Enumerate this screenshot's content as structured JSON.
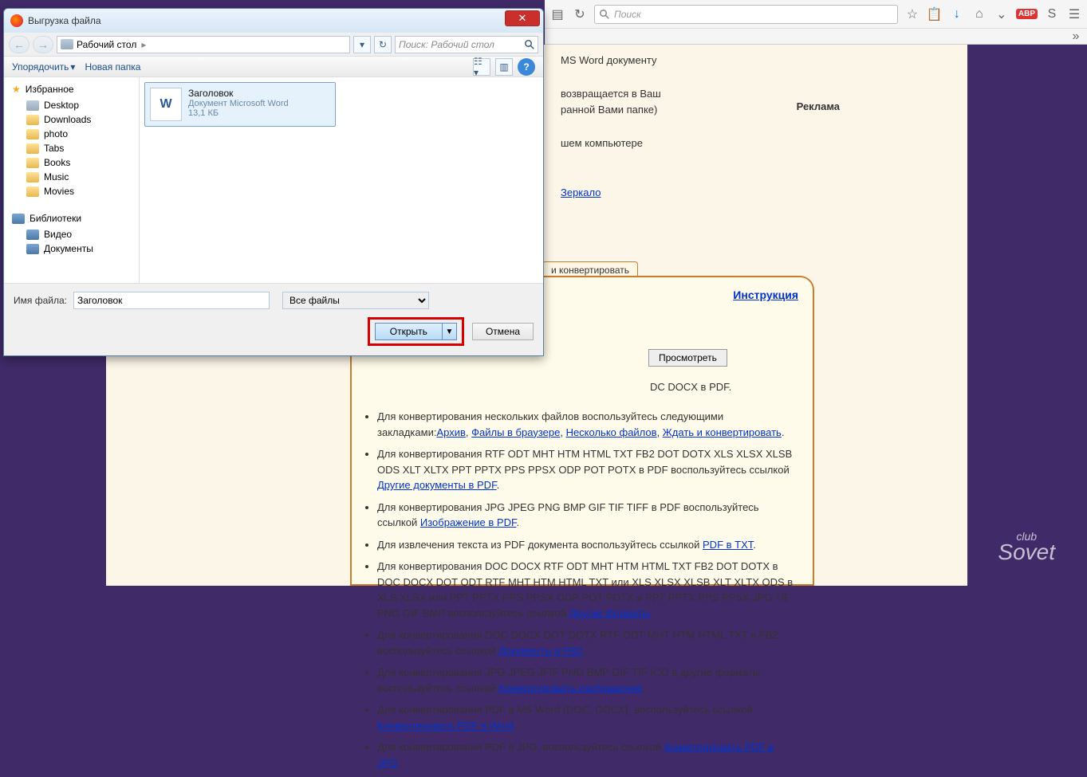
{
  "toolbar": {
    "search_placeholder": "Поиск"
  },
  "page": {
    "headline_frag": "MS Word документу",
    "reklama": "Реклама",
    "line2a": "возвращается в Ваш",
    "line2b": "ранной Вами папке)",
    "line3": "шем компьютере",
    "mirror": "Зеркало",
    "tab_convert": "и конвертировать",
    "instruction": "Инструкция",
    "browse": "Просмотреть",
    "docx_line": "DC DOCX в PDF.",
    "logo1": "club",
    "logo2": "Sovet"
  },
  "bullets": [
    {
      "pre": "Для конвертирования нескольких файлов воспользуйтесь следующими закладками:",
      "links": [
        "Архив",
        "Файлы в браузере",
        "Несколько файлов",
        "Ждать и конвертировать"
      ],
      "post": "."
    },
    {
      "pre": "Для конвертирования RTF ODT MHT HTM HTML TXT FB2 DOT DOTX XLS XLSX XLSB ODS XLT XLTX PPT PPTX PPS PPSX ODP POT POTX в PDF воспользуйтесь ссылкой ",
      "links": [
        "Другие документы в PDF"
      ],
      "post": "."
    },
    {
      "pre": "Для конвертирования JPG JPEG PNG BMP GIF TIF TIFF в PDF воспользуйтесь ссылкой ",
      "links": [
        "Изображение в PDF"
      ],
      "post": "."
    },
    {
      "pre": "Для извлечения текста из PDF документа воспользуйтесь ссылкой ",
      "links": [
        "PDF в TXT"
      ],
      "post": "."
    },
    {
      "pre": "Для конвертирования DOC DOCX RTF ODT MHT HTM HTML TXT FB2 DOT DOTX в DOC DOCX DOT ODT RTF MHT HTM HTML TXT или XLS XLSX XLSB XLT XLTX ODS в XLS XLSX или PPT PPTX PPS PPSX ODP POT POTX в PPT PPTX PPS PPSX JPG TIF PNG GIF BMP воспользуйтесь ссылкой ",
      "links": [
        "Другие форматы"
      ],
      "post": "."
    },
    {
      "pre": "Для конвертирования DOC DOCX DOT DOTX RTF ODT MHT HTM HTML TXT в FB2 воспользуйтесь ссылкой ",
      "links": [
        "Документы в FB2"
      ],
      "post": "."
    },
    {
      "pre": "Для конвертирования JPG JPEG JFIF PNG BMP GIF TIF ICO в другие форматы, воспользуйтесь ссылкой ",
      "links": [
        "Конвертировать изображение"
      ],
      "post": "."
    },
    {
      "pre": "Для конвертирования PDF в MS Word (DOC, DOCX), воспользуйтесь ссылкой ",
      "links": [
        "Конвертировать PDF в Word"
      ],
      "post": "."
    },
    {
      "pre": "Для конвертирования PDF в JPG, воспользуйтесь ссылкой ",
      "links": [
        "Конвертировать PDF в JPG"
      ],
      "post": "."
    }
  ],
  "dialog": {
    "title": "Выгрузка файла",
    "crumb": "Рабочий стол",
    "search_placeholder": "Поиск: Рабочий стол",
    "organize": "Упорядочить",
    "new_folder": "Новая папка",
    "fav": "Избранное",
    "fav_items": [
      "Desktop",
      "Downloads",
      "photo",
      "Tabs",
      "Books",
      "Music",
      "Movies"
    ],
    "lib": "Библиотеки",
    "lib_items": [
      "Видео",
      "Документы"
    ],
    "file": {
      "name": "Заголовок",
      "type": "Документ Microsoft Word",
      "size": "13,1 КБ"
    },
    "name_label": "Имя файла:",
    "name_value": "Заголовок",
    "filter": "Все файлы",
    "open": "Открыть",
    "cancel": "Отмена"
  }
}
